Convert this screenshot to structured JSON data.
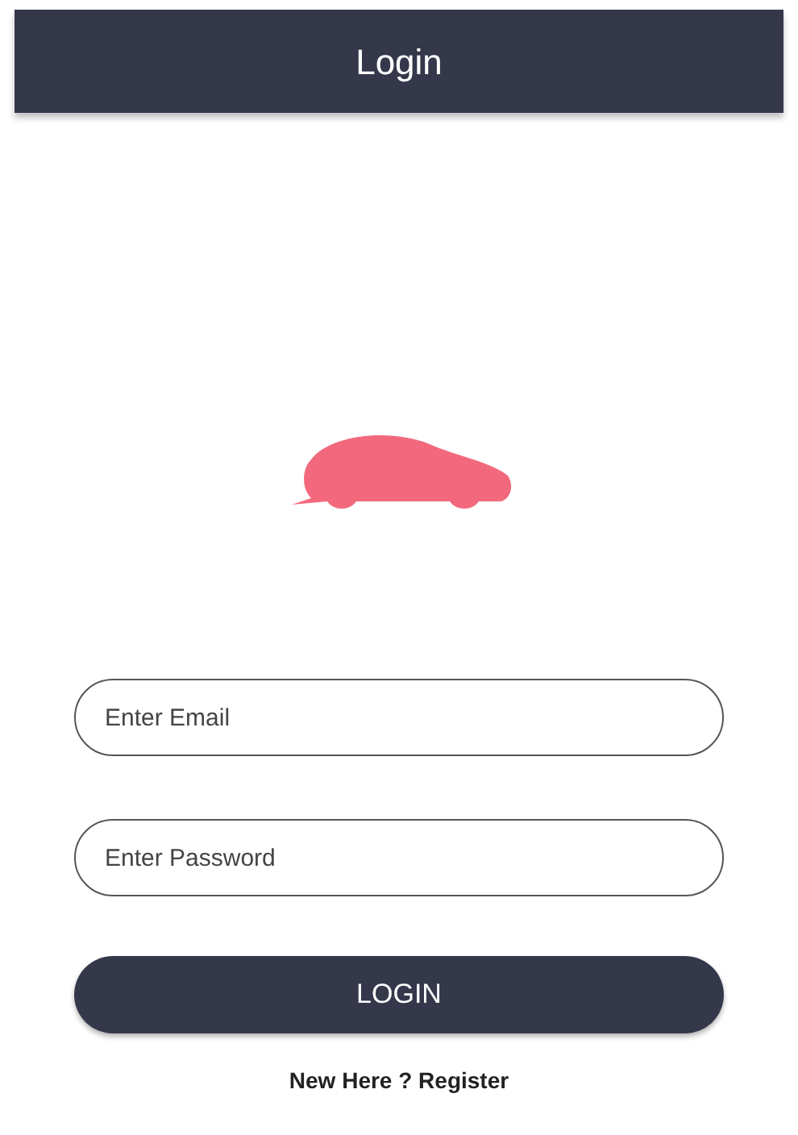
{
  "header": {
    "title": "Login"
  },
  "form": {
    "email": {
      "placeholder": "Enter Email"
    },
    "password": {
      "placeholder": "Enter Password"
    },
    "submit": "LOGIN"
  },
  "register_link": "New Here ? Register"
}
